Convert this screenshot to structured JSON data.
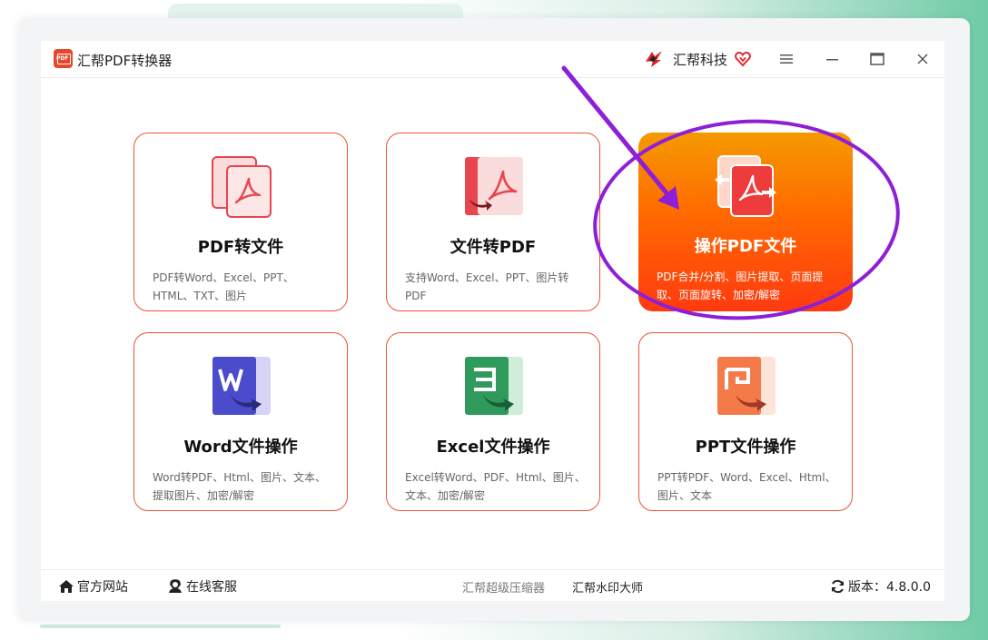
{
  "app": {
    "logo_text": "PDF",
    "title": "汇帮PDF转换器"
  },
  "brand": {
    "name": "汇帮科技"
  },
  "window_controls": {
    "menu": "≡",
    "minimize": "—",
    "maximize": "☐",
    "close": "✕"
  },
  "cards": [
    {
      "id": "pdf-to-file",
      "title": "PDF转文件",
      "desc": "PDF转Word、Excel、PPT、HTML、TXT、图片",
      "icon": "pdf-stack-icon",
      "active": false
    },
    {
      "id": "file-to-pdf",
      "title": "文件转PDF",
      "desc": "支持Word、Excel、PPT、图片转PDF",
      "icon": "file-to-pdf-icon",
      "active": false
    },
    {
      "id": "operate-pdf",
      "title": "操作PDF文件",
      "desc": "PDF合并/分割、图片提取、页面提取、页面旋转、加密/解密",
      "icon": "pdf-operate-icon",
      "active": true
    },
    {
      "id": "word-ops",
      "title": "Word文件操作",
      "desc": "Word转PDF、Html、图片、文本、提取图片、加密/解密",
      "icon": "word-icon",
      "active": false
    },
    {
      "id": "excel-ops",
      "title": "Excel文件操作",
      "desc": "Excel转Word、PDF、Html、图片、文本、加密/解密",
      "icon": "excel-icon",
      "active": false
    },
    {
      "id": "ppt-ops",
      "title": "PPT文件操作",
      "desc": "PPT转PDF、Word、Excel、Html、图片、文本",
      "icon": "ppt-icon",
      "active": false
    }
  ],
  "footer": {
    "official_site": "官方网站",
    "online_service": "在线客服",
    "compressor": "汇帮超级压缩器",
    "watermark": "汇帮水印大师",
    "version": "版本：4.8.0.0"
  },
  "colors": {
    "accent": "#e95437",
    "active_top": "#f59a00",
    "active_bottom": "#ff3a10",
    "annotation": "#8e1fd6"
  }
}
